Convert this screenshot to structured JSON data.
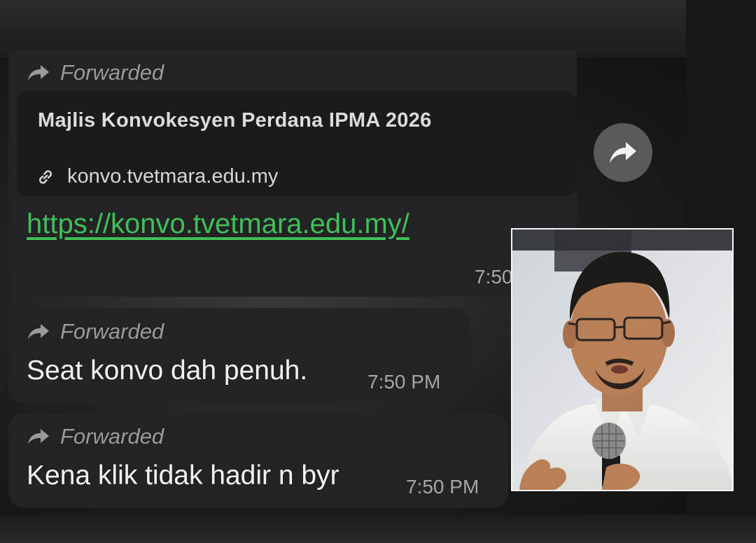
{
  "messages": [
    {
      "forwarded_label": "Forwarded",
      "preview_title": "Majlis Konvokesyen Perdana IPMA 2026",
      "preview_domain": "konvo.tvetmara.edu.my",
      "link": "https://konvo.tvetmara.edu.my/",
      "time": "7:50"
    },
    {
      "forwarded_label": "Forwarded",
      "text": "Seat konvo dah penuh.",
      "time": "7:50 PM"
    },
    {
      "forwarded_label": "Forwarded",
      "text": "Kena klik tidak hadir n byr",
      "time": "7:50 PM"
    }
  ],
  "icons": {
    "forward": "forward-arrow-icon",
    "link": "link-icon",
    "share": "share-forward-icon"
  },
  "colors": {
    "bubble": "#232325",
    "link": "#3fbf57",
    "share_button": "#5a5a5d"
  }
}
